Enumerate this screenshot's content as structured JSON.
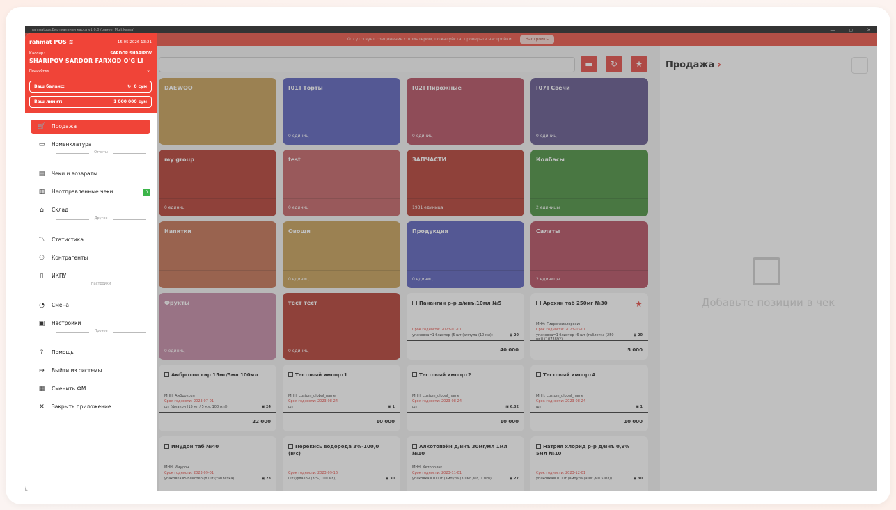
{
  "window": {
    "title": "rahmatpos.Виртуальная касса v1.0.0 (ранее, Multikassa)",
    "controls": [
      "—",
      "◻",
      "✕"
    ]
  },
  "alert": {
    "text": "Отсутствует соединение с принтером, пожалуйста, проверьте настройки.",
    "button": "Настроить"
  },
  "drawer": {
    "brand": "rahmat POS",
    "datetime": "15.05.2026 13:21",
    "cashier_label": "Кассир:",
    "cashier_short": "SARDOR SHARIPOV",
    "cashier_full": "SHARIPOV SARDOR FARXOD O'G'LI",
    "more": "Подробнее",
    "balance_label": "Ваш баланс:",
    "balance_value": "0 сум",
    "limit_label": "Ваш лимит:",
    "limit_value": "1 000 000 сум",
    "menu": [
      {
        "label": "Продажа",
        "icon": "cart-icon"
      },
      {
        "label": "Номенклатура",
        "icon": "folder-icon"
      },
      {
        "label": "Чеки и возвраты",
        "icon": "receipt-icon"
      },
      {
        "label": "Неотправленные чеки",
        "icon": "unsent-receipt-icon",
        "badge": "0"
      },
      {
        "label": "Склад",
        "icon": "warehouse-icon"
      },
      {
        "label": "Статистика",
        "icon": "chart-icon"
      },
      {
        "label": "Контрагенты",
        "icon": "users-icon"
      },
      {
        "label": "ИКПУ",
        "icon": "book-icon"
      },
      {
        "label": "Смена",
        "icon": "shift-icon"
      },
      {
        "label": "Настройки",
        "icon": "settings-icon"
      },
      {
        "label": "Помощь",
        "icon": "help-icon"
      },
      {
        "label": "Выйти из системы",
        "icon": "logout-icon"
      },
      {
        "label": "Сменить ФМ",
        "icon": "fm-icon"
      },
      {
        "label": "Закрыть приложение",
        "icon": "close-icon"
      }
    ],
    "sections": [
      "Отчеты",
      "Другое",
      "Настройки",
      "Прочее"
    ]
  },
  "categories": [
    {
      "name": "DAEWOO",
      "count": "",
      "color": "#c39a4e"
    },
    {
      "name": "[01] Торты",
      "count": "0 единиц",
      "color": "#5257b8"
    },
    {
      "name": "[02] Пирожные",
      "count": "0 единиц",
      "color": "#b04458"
    },
    {
      "name": "[07] Свечи",
      "count": "0 единиц",
      "color": "#5a4d86"
    },
    {
      "name": "my group",
      "count": "0 единиц",
      "color": "#b03328"
    },
    {
      "name": "test",
      "count": "0 единиц",
      "color": "#c15a5c"
    },
    {
      "name": "ЗАПЧАСТИ",
      "count": "1931 единица",
      "color": "#b03328"
    },
    {
      "name": "Колбасы",
      "count": "2 единицы",
      "color": "#3f8a34"
    },
    {
      "name": "Напитки",
      "count": "",
      "color": "#c06a4a"
    },
    {
      "name": "Овощи",
      "count": "0 единиц",
      "color": "#c39a4e"
    },
    {
      "name": "Продукция",
      "count": "0 единиц",
      "color": "#5257b8"
    },
    {
      "name": "Салаты",
      "count": "2 единицы",
      "color": "#b04458"
    },
    {
      "name": "Фрукты",
      "count": "0 единиц",
      "color": "#c184a0"
    },
    {
      "name": "тест тест",
      "count": "0 единиц",
      "color": "#b03328"
    }
  ],
  "products": [
    {
      "name": "Панангин р-р д/инъ,10мл №5",
      "mnn": "",
      "expiry": "Срок годности: 2023-01-01",
      "pack": "упаковка=1 блистер (5 шт (ампула (10 мл))",
      "stock": "20",
      "price": "40 000",
      "fav": false
    },
    {
      "name": "Арехин таб 250мг №30",
      "mnn": "МНН: Гидроксихлорохин",
      "expiry": "Срок годности: 2023-03-01",
      "pack": "упаковка=1 блистер (6 шт (таблетка (250 мг)) (1073892)",
      "stock": "20",
      "price": "5 000",
      "fav": true
    },
    {
      "name": "Амброхол сир 15мг/5мл 100мл",
      "mnn": "МНН: Амброксол",
      "expiry": "Срок годности: 2023-07-01",
      "pack": "шт (флакон (15 мг / 5 мл, 100 мл))",
      "stock": "24",
      "price": "22 000",
      "fav": false
    },
    {
      "name": "Тестовый импорт1",
      "mnn": "МНН: custom_global_name",
      "expiry": "Срок годности: 2023-08-24",
      "pack": "шт.",
      "stock": "1",
      "price": "10 000",
      "fav": false
    },
    {
      "name": "Тестовый импорт2",
      "mnn": "МНН: custom_global_name",
      "expiry": "Срок годности: 2023-08-24",
      "pack": "шт.",
      "stock": "6.32",
      "price": "10 000",
      "fav": false
    },
    {
      "name": "Тестовый импорт4",
      "mnn": "МНН: custom_global_name",
      "expiry": "Срок годности: 2023-08-24",
      "pack": "шт.",
      "stock": "1",
      "price": "10 000",
      "fav": false
    },
    {
      "name": "Имудон таб №40",
      "mnn": "МНН: Имудон",
      "expiry": "Срок годности: 2023-09-01",
      "pack": "упаковка=5 блистер (8 шт (таблетка)",
      "stock": "23",
      "price": "",
      "fav": false
    },
    {
      "name": "Перекись водорода 3%-100,0 (н/с)",
      "mnn": "",
      "expiry": "Срок годности: 2023-09-16",
      "pack": "шт (флакон (3 %, 100 мл))",
      "stock": "30",
      "price": "",
      "fav": false
    },
    {
      "name": "Алкотопэйн д/инъ 30мг/мл 1мл №10",
      "mnn": "МНН: Кеторолак",
      "expiry": "Срок годности: 2023-11-01",
      "pack": "упаковка=10 шт (ампула (30 мг /мл, 1 мл))",
      "stock": "27",
      "price": "",
      "fav": false
    },
    {
      "name": "Натрия хлорид р-р д/инъ 0,9% 5мл №10",
      "mnn": "",
      "expiry": "Срок годности: 2023-12-01",
      "pack": "упаковка=10 шт (ампула (9 мг /мл 5 мл))",
      "stock": "30",
      "price": "",
      "fav": false
    }
  ],
  "cart": {
    "title": "Продажа",
    "empty_text": "Добавьте позиции в чек"
  }
}
